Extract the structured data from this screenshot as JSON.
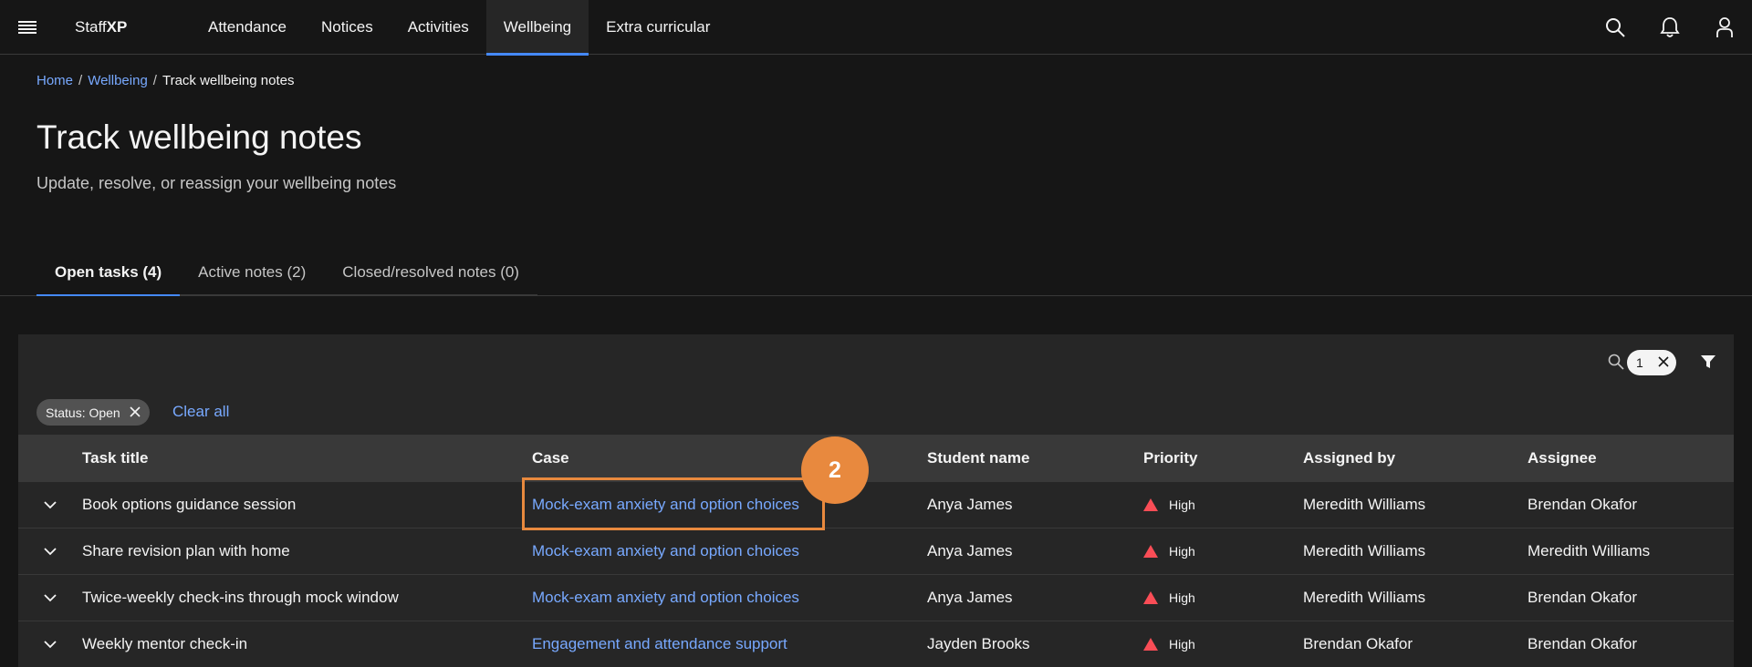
{
  "header": {
    "brand_prefix": "Staff",
    "brand_suffix": "XP",
    "nav": [
      {
        "label": "Attendance",
        "active": false
      },
      {
        "label": "Notices",
        "active": false
      },
      {
        "label": "Activities",
        "active": false
      },
      {
        "label": "Wellbeing",
        "active": true
      },
      {
        "label": "Extra curricular",
        "active": false
      }
    ],
    "icons": [
      "menu-icon",
      "search-icon",
      "notification-icon",
      "user-icon"
    ]
  },
  "breadcrumb": {
    "home": "Home",
    "sep": "/",
    "section": "Wellbeing",
    "current": "Track wellbeing notes"
  },
  "page": {
    "title": "Track wellbeing notes",
    "subtitle": "Update, resolve, or reassign your wellbeing notes"
  },
  "tabs": [
    {
      "label": "Open tasks (4)",
      "active": true
    },
    {
      "label": "Active notes (2)",
      "active": false
    },
    {
      "label": "Closed/resolved notes (0)",
      "active": false
    }
  ],
  "toolbar": {
    "search_count": "1",
    "filter_tag": "Status: Open",
    "clear_all": "Clear all"
  },
  "table": {
    "columns": [
      "Task title",
      "Case",
      "Student name",
      "Priority",
      "Assigned by",
      "Assignee"
    ],
    "rows": [
      {
        "task": "Book options guidance session",
        "case": "Mock-exam anxiety and option choices",
        "student": "Anya James",
        "priority": "High",
        "assigned_by": "Meredith Williams",
        "assignee": "Brendan Okafor"
      },
      {
        "task": "Share revision plan with home",
        "case": "Mock-exam anxiety and option choices",
        "student": "Anya James",
        "priority": "High",
        "assigned_by": "Meredith Williams",
        "assignee": "Meredith Williams"
      },
      {
        "task": "Twice-weekly check-ins through mock window",
        "case": "Mock-exam anxiety and option choices",
        "student": "Anya James",
        "priority": "High",
        "assigned_by": "Meredith Williams",
        "assignee": "Brendan Okafor"
      },
      {
        "task": "Weekly mentor check-in",
        "case": "Engagement and attendance support",
        "student": "Jayden Brooks",
        "priority": "High",
        "assigned_by": "Brendan Okafor",
        "assignee": "Brendan Okafor"
      }
    ]
  },
  "annotation": {
    "badge": "2"
  },
  "colors": {
    "accent": "#4589ff",
    "link": "#78a9ff",
    "priority_high": "#fa4d56",
    "annotation": "#e8893e"
  }
}
